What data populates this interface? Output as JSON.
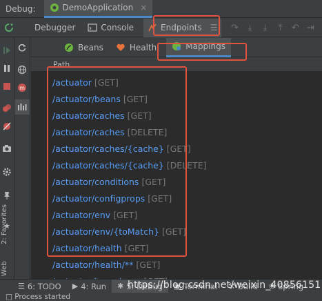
{
  "top_bar": {
    "label": "Debug:",
    "run_tab": "DemoApplication",
    "close": "×"
  },
  "debug_tabs": [
    {
      "label": "Debugger"
    },
    {
      "label": "Console"
    },
    {
      "label": "Endpoints"
    }
  ],
  "sub_tabs": [
    {
      "label": "Beans"
    },
    {
      "label": "Health"
    },
    {
      "label": "Mappings"
    }
  ],
  "table": {
    "column_header": "Path",
    "rows": [
      {
        "path": "/actuator",
        "method": "[GET]"
      },
      {
        "path": "/actuator/beans",
        "method": "[GET]"
      },
      {
        "path": "/actuator/caches",
        "method": "[GET]"
      },
      {
        "path": "/actuator/caches",
        "method": "[DELETE]"
      },
      {
        "path": "/actuator/caches/{cache}",
        "method": "[GET]"
      },
      {
        "path": "/actuator/caches/{cache}",
        "method": "[DELETE]"
      },
      {
        "path": "/actuator/conditions",
        "method": "[GET]"
      },
      {
        "path": "/actuator/configprops",
        "method": "[GET]"
      },
      {
        "path": "/actuator/env",
        "method": "[GET]"
      },
      {
        "path": "/actuator/env/{toMatch}",
        "method": "[GET]"
      },
      {
        "path": "/actuator/health",
        "method": "[GET]"
      },
      {
        "path": "/actuator/health/**",
        "method": "[GET]"
      },
      {
        "path": "/actuator/heapdump",
        "method": "[GET]"
      }
    ]
  },
  "side_labels": {
    "favorites": "2: Favorites",
    "web": "Web"
  },
  "bottom_tabs": [
    {
      "label": "6: TODO"
    },
    {
      "label": "4: Run"
    },
    {
      "label": "5: Debug"
    },
    {
      "label": "Terminal"
    },
    {
      "label": "Build"
    },
    {
      "label": "Spring"
    }
  ],
  "status": "Process started",
  "watermark": "https://blog.csdn.net/weixin_40856151",
  "colors": {
    "path": "#589df6",
    "method": "#787878",
    "highlight": "#e0533e"
  }
}
